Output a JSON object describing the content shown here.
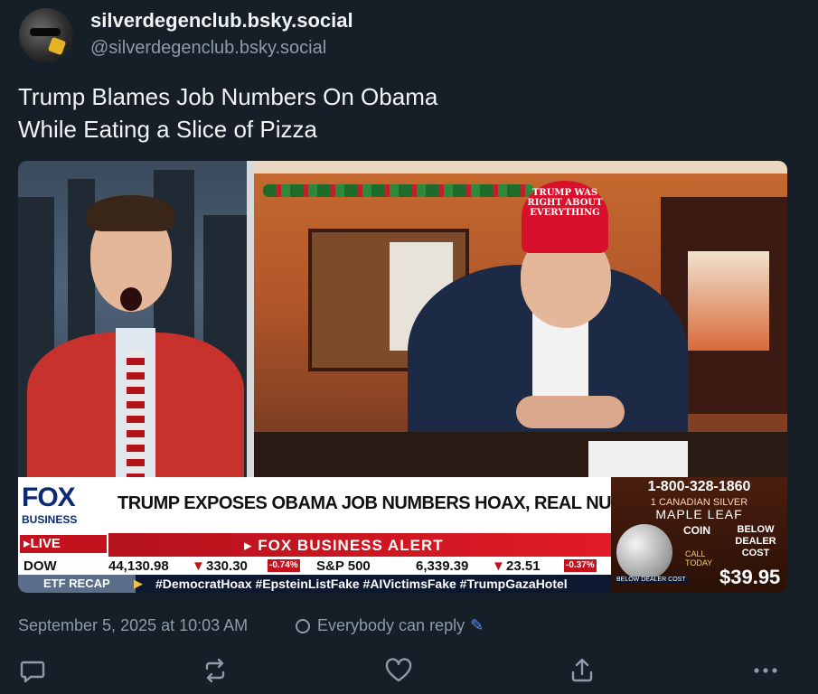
{
  "post": {
    "author": {
      "display_name": "silverdegenclub.bsky.social",
      "handle": "@silverdegenclub.bsky.social"
    },
    "text": "Trump Blames Job Numbers On Obama\nWhile Eating a Slice of Pizza",
    "timestamp": "September 5, 2025 at 10:03 AM",
    "reply_setting": "Everybody can reply"
  },
  "media": {
    "hat_text": "TRUMP WAS\nRIGHT ABOUT\nEVERYTHING",
    "logo_fox": "FOX",
    "logo_business": "BUSINESS",
    "live_label": "LIVE",
    "headline": "TRUMP EXPOSES OBAMA JOB NUMBERS HOAX, REAL NUMBERS BIGGEST",
    "alert": "FOX BUSINESS ALERT",
    "ticker": {
      "dow_label": "DOW",
      "dow_value": "44,130.98",
      "dow_change": "330.30",
      "dow_pct": "-0.74%",
      "sp_label": "S&P 500",
      "sp_value": "6,339.39",
      "sp_change": "23.51",
      "sp_pct": "-0.37%"
    },
    "etf_recap": "ETF RECAP",
    "hashtags": "#DemocratHoax #EpsteinListFake #AIVictimsFake #TrumpGazaHotel",
    "ad": {
      "phone": "1-800-328-1860",
      "line1": "1 CANADIAN SILVER",
      "line2": "MAPLE LEAF",
      "coin": "COIN",
      "below_dealer": "BELOW\nDEALER\nCOST",
      "call_today": "CALL\nTODAY",
      "price": "$39.95",
      "below_dealer_cost": "BELOW DEALER COST"
    }
  },
  "colors": {
    "background": "#161e27",
    "text_primary": "#f1f3f5",
    "text_muted": "#8d9bab",
    "accent": "#5b8cf0",
    "fox_red": "#c3121e",
    "fox_navy": "#0b2a73"
  },
  "actions": [
    {
      "name": "reply",
      "icon": "reply-icon"
    },
    {
      "name": "repost",
      "icon": "repost-icon"
    },
    {
      "name": "like",
      "icon": "heart-icon"
    },
    {
      "name": "share",
      "icon": "share-icon"
    },
    {
      "name": "more",
      "icon": "more-icon"
    }
  ]
}
